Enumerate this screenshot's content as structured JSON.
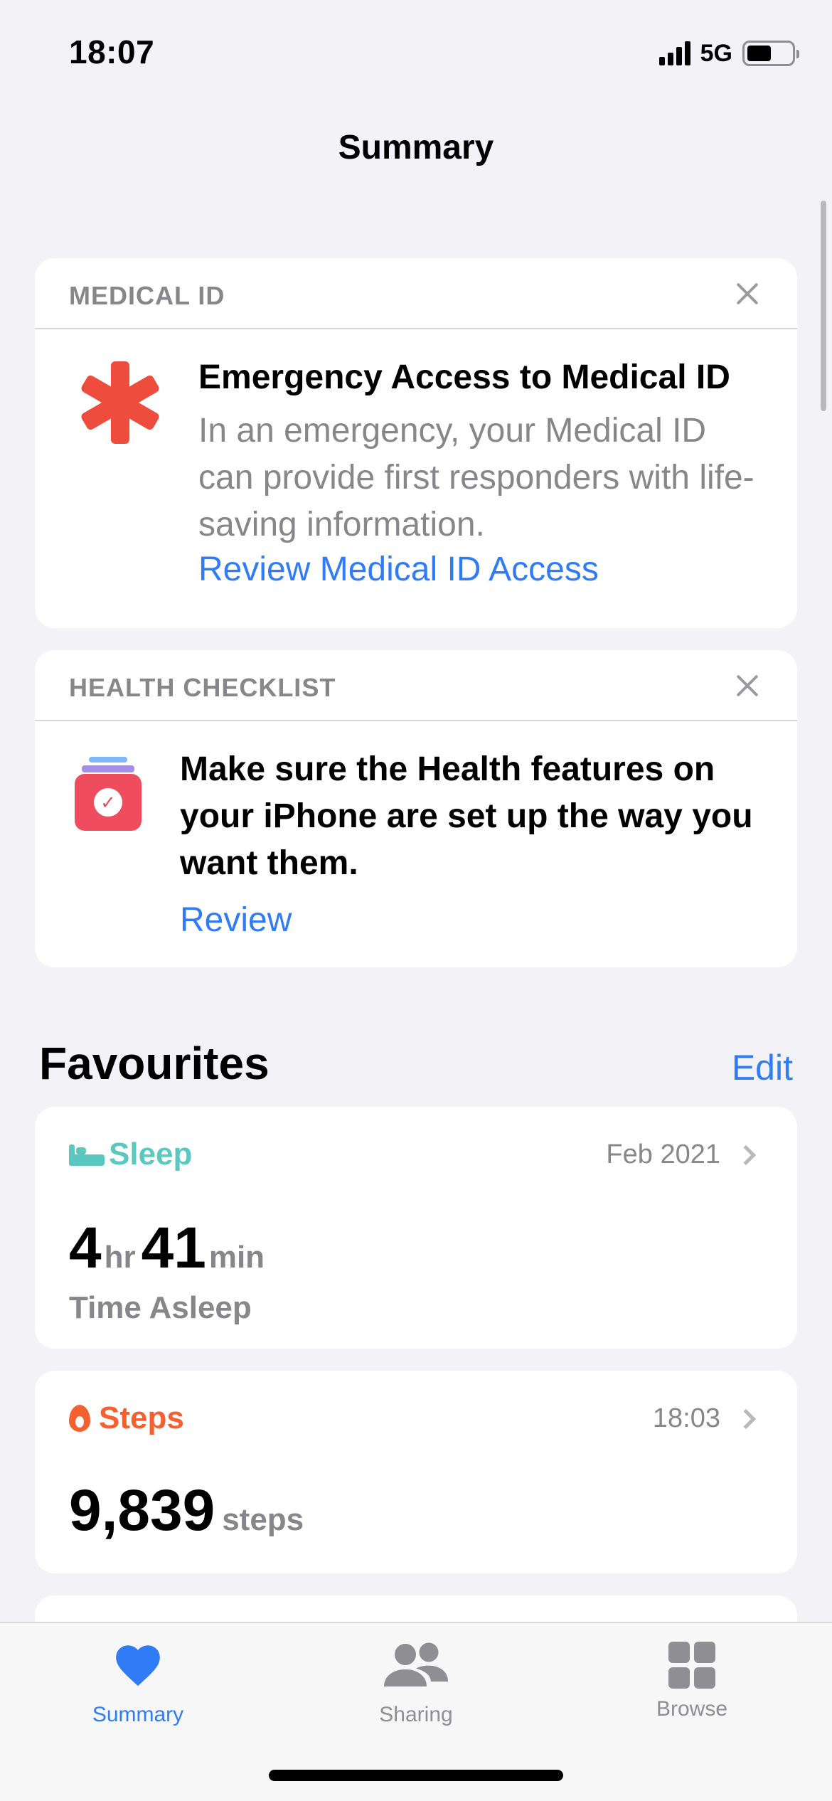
{
  "status_bar": {
    "time": "18:07",
    "network": "5G"
  },
  "nav": {
    "title": "Summary"
  },
  "medical_card": {
    "header": "MEDICAL ID",
    "title": "Emergency Access to Medical ID",
    "body": "In an emergency, your Medical ID can provide first responders with life-saving information.",
    "link": "Review Medical ID Access"
  },
  "checklist_card": {
    "header": "HEALTH CHECKLIST",
    "body": "Make sure the Health features on your iPhone are set up the way you want them.",
    "link": "Review"
  },
  "favourites": {
    "heading": "Favourites",
    "edit_label": "Edit",
    "sleep": {
      "category": "Sleep",
      "date": "Feb 2021",
      "hours": "4",
      "hours_unit": "hr",
      "minutes": "41",
      "minutes_unit": "min",
      "label": "Time Asleep",
      "color": "#5ac8be"
    },
    "steps": {
      "category": "Steps",
      "time": "18:03",
      "value": "9,839",
      "unit": "steps",
      "color": "#f5602e"
    }
  },
  "tab_bar": {
    "tabs": [
      {
        "label": "Summary",
        "icon": "heart-icon",
        "active": true
      },
      {
        "label": "Sharing",
        "icon": "people-icon",
        "active": false
      },
      {
        "label": "Browse",
        "icon": "grid-icon",
        "active": false
      }
    ]
  },
  "colors": {
    "accent": "#2f7cf6",
    "medical_red": "#ee4d3d"
  }
}
